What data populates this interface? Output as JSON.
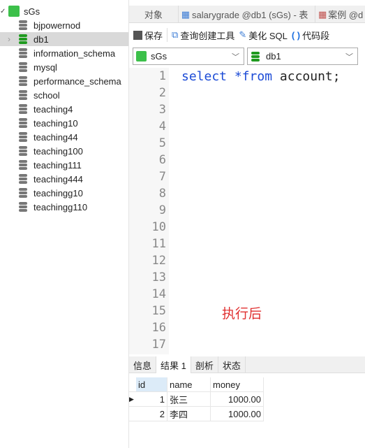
{
  "sidebar": {
    "connection": "sGs",
    "databases": [
      {
        "name": "bjpowernod",
        "active": false
      },
      {
        "name": "db1",
        "active": true
      },
      {
        "name": "information_schema",
        "active": false
      },
      {
        "name": "mysql",
        "active": false
      },
      {
        "name": "performance_schema",
        "active": false
      },
      {
        "name": "school",
        "active": false
      },
      {
        "name": "teaching4",
        "active": false
      },
      {
        "name": "teaching10",
        "active": false
      },
      {
        "name": "teaching44",
        "active": false
      },
      {
        "name": "teaching100",
        "active": false
      },
      {
        "name": "teaching111",
        "active": false
      },
      {
        "name": "teaching444",
        "active": false
      },
      {
        "name": "teachingg10",
        "active": false
      },
      {
        "name": "teachingg110",
        "active": false
      }
    ]
  },
  "tabs": [
    "对象",
    "salarygrade @db1 (sGs) - 表",
    "案例 @d"
  ],
  "toolbar": {
    "save": "保存",
    "query_builder": "查询创建工具",
    "beautify": "美化 SQL",
    "snippet": "代码段"
  },
  "selectors": {
    "connection": "sGs",
    "database": "db1"
  },
  "editor": {
    "kw1": "select",
    "kw2": "*from",
    "rest": " account;",
    "line_count": 17
  },
  "annotation": "执行后",
  "result_tabs": [
    "信息",
    "结果 1",
    "剖析",
    "状态"
  ],
  "active_result_tab": "结果 1",
  "grid": {
    "columns": [
      "id",
      "name",
      "money"
    ],
    "rows": [
      [
        "1",
        "张三",
        "1000.00"
      ],
      [
        "2",
        "李四",
        "1000.00"
      ]
    ]
  },
  "colors": {
    "accent_green": "#2aa52a",
    "keyword": "#1c4bd6",
    "annotation": "#e03030"
  }
}
